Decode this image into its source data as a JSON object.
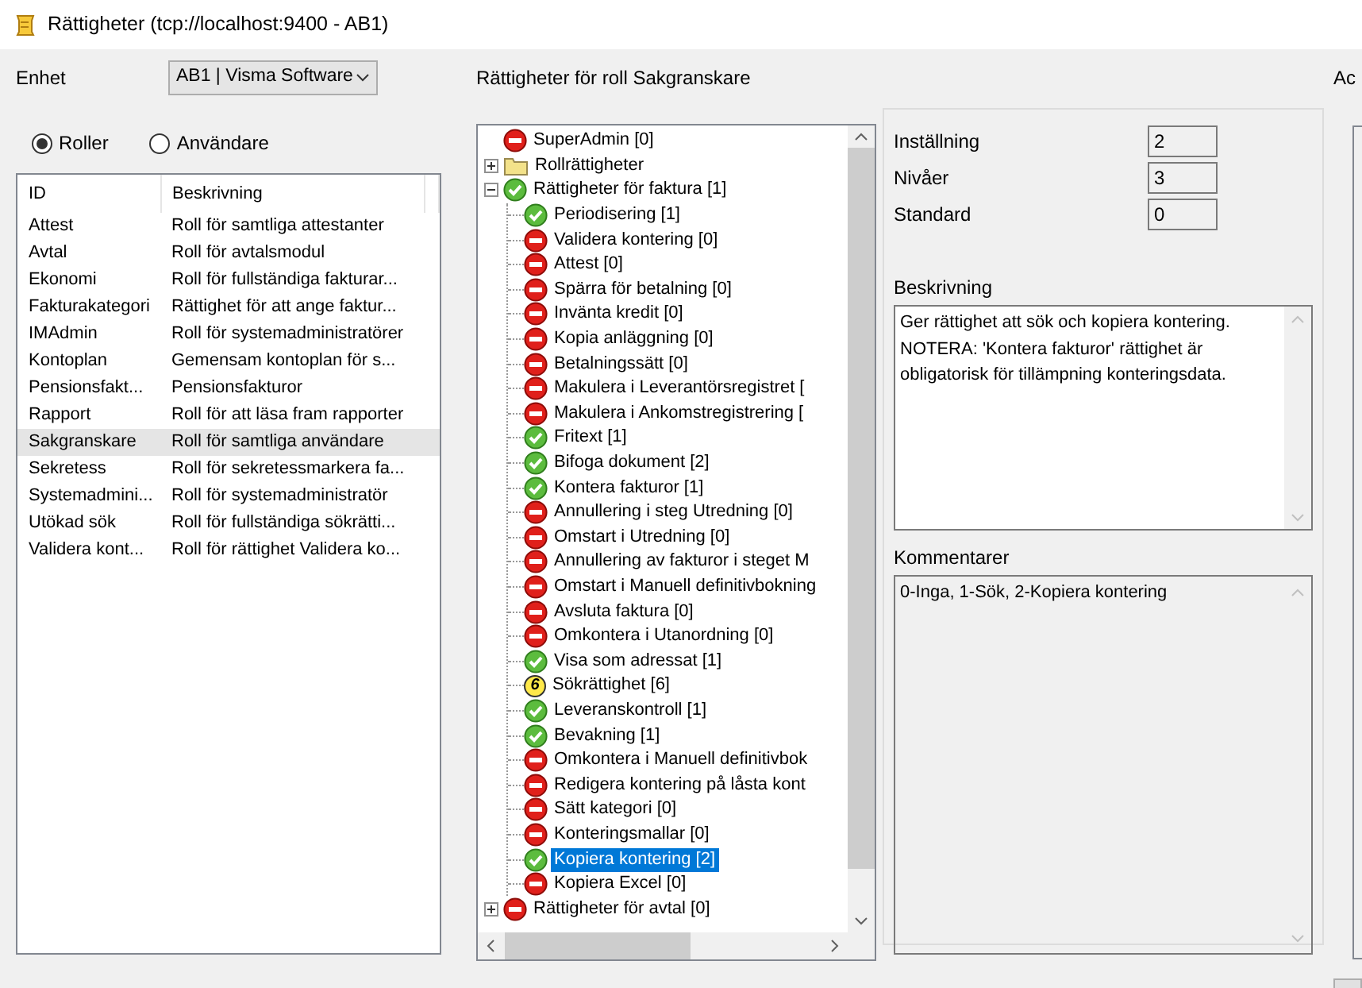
{
  "window": {
    "title": "Rättigheter (tcp://localhost:9400 - AB1)"
  },
  "unit": {
    "label": "Enhet",
    "value": "AB1 | Visma Software"
  },
  "view_mode": [
    {
      "label": "Roller",
      "selected": true
    },
    {
      "label": "Användare",
      "selected": false
    }
  ],
  "roles": {
    "columns": [
      "ID",
      "Beskrivning"
    ],
    "rows": [
      {
        "id": "Attest",
        "description": "Roll för samtliga attestanter",
        "selected": false
      },
      {
        "id": "Avtal",
        "description": "Roll för avtalsmodul",
        "selected": false
      },
      {
        "id": "Ekonomi",
        "description": "Roll för fullständiga fakturar...",
        "selected": false
      },
      {
        "id": "Fakturakategori",
        "description": "Rättighet för att ange faktur...",
        "selected": false
      },
      {
        "id": "IMAdmin",
        "description": "Roll för systemadministratörer",
        "selected": false
      },
      {
        "id": "Kontoplan",
        "description": "Gemensam kontoplan för s...",
        "selected": false
      },
      {
        "id": "Pensionsfakt...",
        "description": "Pensionsfakturor",
        "selected": false
      },
      {
        "id": "Rapport",
        "description": "Roll för att läsa fram rapporter",
        "selected": false
      },
      {
        "id": "Sakgranskare",
        "description": "Roll för samtliga användare",
        "selected": true
      },
      {
        "id": "Sekretess",
        "description": "Roll för sekretessmarkera fa...",
        "selected": false
      },
      {
        "id": "Systemadmini...",
        "description": "Roll för systemadministratör",
        "selected": false
      },
      {
        "id": "Utökad sök",
        "description": "Roll för fullständiga sökrätti...",
        "selected": false
      },
      {
        "id": "Validera kont...",
        "description": "Roll för rättighet Validera ko...",
        "selected": false
      }
    ]
  },
  "rights": {
    "heading": "Rättigheter för roll Sakgranskare",
    "tree": [
      {
        "label": "SuperAdmin [0]",
        "kind": "denied",
        "selected": false
      },
      {
        "label": "Rollrättigheter",
        "kind": "folder",
        "expanded": false,
        "selected": false
      },
      {
        "label": "Rättigheter för faktura [1]",
        "kind": "granted",
        "expanded": true,
        "selected": false,
        "children": [
          {
            "label": "Periodisering [1]",
            "kind": "granted",
            "selected": false
          },
          {
            "label": "Validera kontering [0]",
            "kind": "denied",
            "selected": false
          },
          {
            "label": "Attest [0]",
            "kind": "denied",
            "selected": false
          },
          {
            "label": "Spärra för betalning [0]",
            "kind": "denied",
            "selected": false
          },
          {
            "label": "Invänta kredit [0]",
            "kind": "denied",
            "selected": false
          },
          {
            "label": "Kopia anläggning [0]",
            "kind": "denied",
            "selected": false
          },
          {
            "label": "Betalningssätt [0]",
            "kind": "denied",
            "selected": false
          },
          {
            "label": "Makulera i Leverantörsregistret [",
            "kind": "denied",
            "selected": false
          },
          {
            "label": "Makulera i Ankomstregistrering [",
            "kind": "denied",
            "selected": false
          },
          {
            "label": "Fritext [1]",
            "kind": "granted",
            "selected": false
          },
          {
            "label": "Bifoga dokument [2]",
            "kind": "granted",
            "selected": false
          },
          {
            "label": "Kontera fakturor [1]",
            "kind": "granted",
            "selected": false
          },
          {
            "label": "Annullering i steg Utredning [0]",
            "kind": "denied",
            "selected": false
          },
          {
            "label": "Omstart i Utredning [0]",
            "kind": "denied",
            "selected": false
          },
          {
            "label": "Annullering av fakturor i steget M",
            "kind": "denied",
            "selected": false
          },
          {
            "label": "Omstart i Manuell definitivbokning",
            "kind": "denied",
            "selected": false
          },
          {
            "label": "Avsluta faktura [0]",
            "kind": "denied",
            "selected": false
          },
          {
            "label": "Omkontera i Utanordning [0]",
            "kind": "denied",
            "selected": false
          },
          {
            "label": "Visa som adressat [1]",
            "kind": "granted",
            "selected": false
          },
          {
            "label": "Sökrättighet [6]",
            "kind": "level",
            "badge": "6",
            "selected": false
          },
          {
            "label": "Leveranskontroll [1]",
            "kind": "granted",
            "selected": false
          },
          {
            "label": "Bevakning [1]",
            "kind": "granted",
            "selected": false
          },
          {
            "label": "Omkontera i Manuell definitivbok",
            "kind": "denied",
            "selected": false
          },
          {
            "label": "Redigera kontering på låsta kont",
            "kind": "denied",
            "selected": false
          },
          {
            "label": "Sätt kategori [0]",
            "kind": "denied",
            "selected": false
          },
          {
            "label": "Konteringsmallar [0]",
            "kind": "denied",
            "selected": false
          },
          {
            "label": "Kopiera kontering [2]",
            "kind": "granted",
            "selected": true
          },
          {
            "label": "Kopiera Excel [0]",
            "kind": "denied",
            "selected": false
          }
        ]
      },
      {
        "label": "Rättigheter för avtal [0]",
        "kind": "denied",
        "expanded": false,
        "selected": false
      }
    ]
  },
  "details": {
    "fields": [
      {
        "label": "Inställning",
        "value": "2"
      },
      {
        "label": "Nivåer",
        "value": "3"
      },
      {
        "label": "Standard",
        "value": "0"
      }
    ],
    "description": {
      "label": "Beskrivning",
      "text": "Ger rättighet att sök och kopiera kontering.\nNOTERA: 'Kontera fakturor' rättighet är obligatorisk för tillämpning konteringsdata."
    },
    "comments": {
      "label": "Kommentarer",
      "text": "0-Inga, 1-Sök, 2-Kopiera kontering"
    }
  },
  "column_4": {
    "heading": "Ac"
  }
}
